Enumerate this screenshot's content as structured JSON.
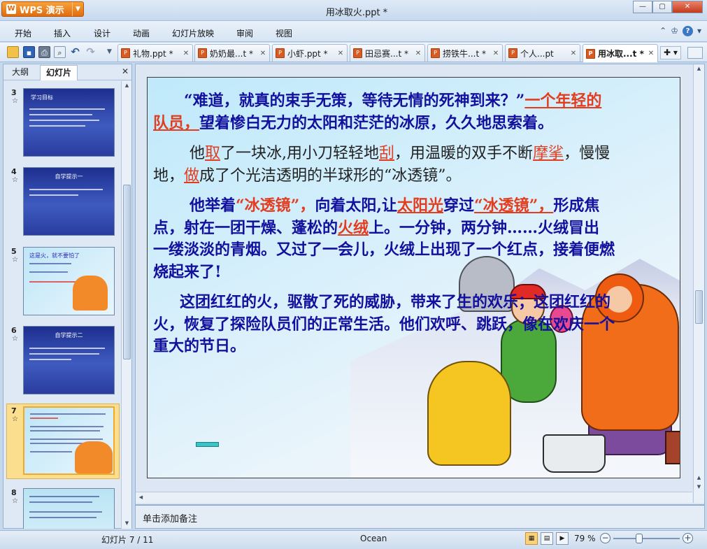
{
  "app": {
    "name": "WPS 演示",
    "window_title": "用冰取火.ppt *"
  },
  "menu": [
    "开始",
    "插入",
    "设计",
    "动画",
    "幻灯片放映",
    "审阅",
    "视图"
  ],
  "doc_tabs": [
    {
      "label": "礼物.ppt *",
      "active": false
    },
    {
      "label": "奶奶最...t *",
      "active": false
    },
    {
      "label": "小虾.ppt *",
      "active": false
    },
    {
      "label": "田忌赛...t *",
      "active": false
    },
    {
      "label": "捞铁牛...t *",
      "active": false
    },
    {
      "label": "个人...pt",
      "active": false
    },
    {
      "label": "用冰取...t *",
      "active": true
    }
  ],
  "left_panel": {
    "tabs": [
      "大纲",
      "幻灯片"
    ],
    "active_tab": "幻灯片",
    "slides": [
      {
        "number": "3",
        "title": "学习目标"
      },
      {
        "number": "4",
        "title": "自学提示一"
      },
      {
        "number": "5",
        "title": "这是火，就不要怕了"
      },
      {
        "number": "6",
        "title": "自学提示二"
      },
      {
        "number": "7",
        "title": ""
      },
      {
        "number": "8",
        "title": ""
      }
    ],
    "selected_slide": "7"
  },
  "slide": {
    "p1_quote": "“难道，就真的束手无策，等待无情的死神到来？”",
    "p1_red": "一个年轻的队员，",
    "p1_rest": "望着惨白无力的太阳和茫茫的冰原，久久地思索着。",
    "p2_a": "他",
    "p2_b": "取",
    "p2_c": "了一块冰,用小刀轻轻地",
    "p2_d": "刮",
    "p2_e": "，用温暖的双手不断",
    "p2_f": "摩挲",
    "p2_g": "，慢慢地，",
    "p2_h": "做",
    "p2_i": "成了个光洁透明的半球形的“冰透镜”。",
    "p3_a": "他举着",
    "p3_b": "“冰透镜”，",
    "p3_c": "向着太阳,让",
    "p3_d": "太阳光",
    "p3_e": "穿过",
    "p3_f": "“冰透镜”，",
    "p3_g": "形成焦点，射在一团干燥、蓬松的",
    "p3_h": "火绒",
    "p3_i": "上。一分钟，两分钟……火绒冒出一缕淡淡的青烟。又过了一会儿，火绒上出现了一个红点，接着便燃烧起来了!",
    "p4": "这团红红的火，驱散了死的威胁，带来了生的欢乐；这团红红的火，恢复了探险队员们的正常生活。他们欢呼、跳跃，像在欢庆一个重大的节日。"
  },
  "notes_placeholder": "单击添加备注",
  "status": {
    "slide_counter": "幻灯片 7 / 11",
    "theme": "Ocean",
    "zoom": "79 %"
  },
  "colors": {
    "text_blue": "#13109e",
    "highlight_red": "#e23d1f",
    "app_orange": "#e06d10"
  }
}
